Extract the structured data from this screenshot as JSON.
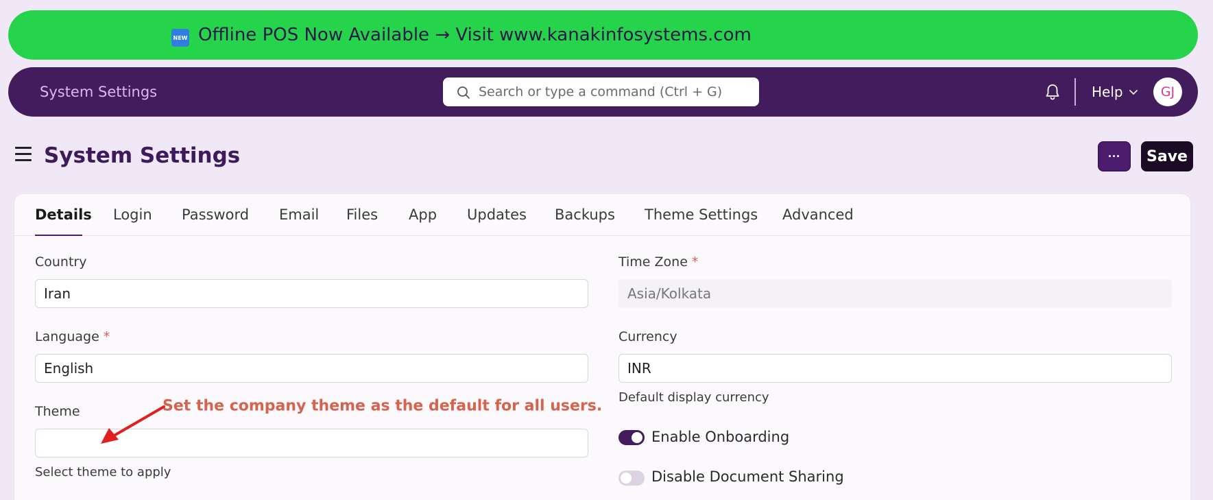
{
  "banner": {
    "badge": "NEW",
    "text": "Offline POS Now Available → Visit www.kanakinfosystems.com",
    "color": "#25d44b"
  },
  "navbar": {
    "title": "System Settings",
    "search_placeholder": "Search or type a command (Ctrl + G)",
    "help_label": "Help",
    "avatar_initials": "GJ",
    "color": "#431c5d"
  },
  "page": {
    "title": "System Settings",
    "more_label": "···",
    "save_label": "Save"
  },
  "tabs": [
    {
      "label": "Details",
      "active": true
    },
    {
      "label": "Login"
    },
    {
      "label": "Password"
    },
    {
      "label": "Email"
    },
    {
      "label": "Files"
    },
    {
      "label": "App"
    },
    {
      "label": "Updates"
    },
    {
      "label": "Backups"
    },
    {
      "label": "Theme Settings"
    },
    {
      "label": "Advanced"
    }
  ],
  "form": {
    "country": {
      "label": "Country",
      "value": "Iran"
    },
    "language": {
      "label": "Language",
      "required": "*",
      "value": "English"
    },
    "theme": {
      "label": "Theme",
      "value": "",
      "help": "Select theme to apply"
    },
    "time_zone": {
      "label": "Time Zone",
      "required": "*",
      "value": "Asia/Kolkata"
    },
    "currency": {
      "label": "Currency",
      "value": "INR",
      "help": "Default display currency"
    },
    "enable_onboarding": {
      "label": "Enable Onboarding",
      "checked": true
    },
    "disable_document_sharing": {
      "label": "Disable Document Sharing",
      "checked": false
    }
  },
  "annotation": {
    "text": "Set the company theme as the default for all users.",
    "color": "#d4634f"
  }
}
